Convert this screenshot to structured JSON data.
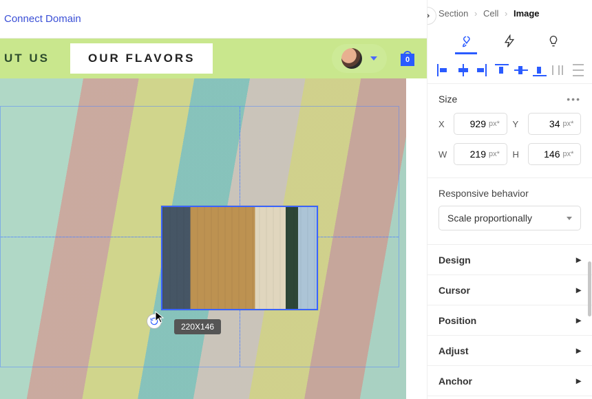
{
  "topbar": {
    "connect_domain": "Connect Domain"
  },
  "nav": {
    "item_about": "UT US",
    "item_flavors": "OUR FLAVORS",
    "cart_count": "0"
  },
  "selection": {
    "size_badge": "220X146"
  },
  "breadcrumb": {
    "section": "Section",
    "cell": "Cell",
    "image": "Image"
  },
  "size": {
    "heading": "Size",
    "x_label": "X",
    "x_value": "929",
    "x_unit": "px*",
    "y_label": "Y",
    "y_value": "34",
    "y_unit": "px*",
    "w_label": "W",
    "w_value": "219",
    "w_unit": "px*",
    "h_label": "H",
    "h_value": "146",
    "h_unit": "px*"
  },
  "responsive": {
    "label": "Responsive behavior",
    "selected": "Scale proportionally"
  },
  "accordion": {
    "design": "Design",
    "cursor": "Cursor",
    "position": "Position",
    "adjust": "Adjust",
    "anchor": "Anchor"
  },
  "icons": {
    "brush": "brush-icon",
    "bolt": "bolt-icon",
    "bulb": "bulb-icon"
  }
}
